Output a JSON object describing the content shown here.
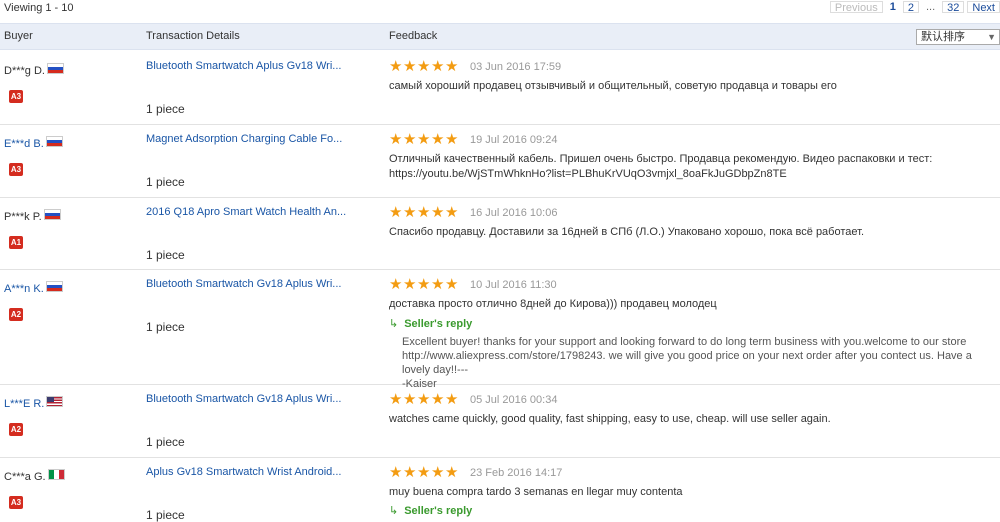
{
  "pagination": {
    "viewing": "Viewing 1 - 10",
    "prev": "Previous",
    "current": "1",
    "page2": "2",
    "ellipsis": "...",
    "last": "32",
    "next": "Next"
  },
  "columns": {
    "buyer": "Buyer",
    "transaction": "Transaction Details",
    "feedback": "Feedback",
    "sort": "默认排序"
  },
  "reviews": [
    {
      "buyer": "D***g D.",
      "flag": "ru",
      "badge": "A3",
      "product": "Bluetooth Smartwatch Aplus Gv18 Wri...",
      "qty": "1 piece",
      "stars": 5,
      "date": "03 Jun 2016 17:59",
      "text": "самый хороший продавец отзывчивый и общительный, советую продавца и товары его"
    },
    {
      "buyer": "E***d B.",
      "flag": "ru",
      "badge": "A3",
      "product": "Magnet Adsorption Charging Cable Fo...",
      "qty": "1 piece",
      "stars": 5,
      "date": "19 Jul 2016 09:24",
      "text": "Отличный качественный кабель. Пришел очень быстро. Продавца рекомендую. Видео распаковки и тест:",
      "text2": "https://youtu.be/WjSTmWhknHo?list=PLBhuKrVUqO3vmjxl_8oaFkJuGDbpZn8TE"
    },
    {
      "buyer": "P***k P.",
      "flag": "ru",
      "badge": "A1",
      "product": "2016 Q18 Apro Smart Watch Health An...",
      "qty": "1 piece",
      "stars": 5,
      "date": "16 Jul 2016 10:06",
      "text": "Спасибо продавцу. Доставили за 16дней в СПб (Л.О.) Упаковано хорошо, пока всё работает."
    },
    {
      "buyer": "A***n K.",
      "flag": "ru",
      "badge": "A2",
      "product": "Bluetooth Smartwatch Gv18 Aplus Wri...",
      "qty": "1 piece",
      "stars": 5,
      "date": "10 Jul 2016 11:30",
      "text": "доставка просто отлично 8дней до Кирова))) продавец молодец",
      "reply_label": "Seller's reply",
      "reply_line1": "Excellent buyer! thanks for your support and looking forward to do long term business with you.welcome to our store",
      "reply_line2": "http://www.aliexpress.com/store/1798243. we will give you good price on your next order after you contect us. Have a lovely day!!---",
      "reply_line3": "-Kaiser"
    },
    {
      "buyer": "L***E R.",
      "flag": "us",
      "badge": "A2",
      "product": "Bluetooth Smartwatch Gv18 Aplus Wri...",
      "qty": "1 piece",
      "stars": 5,
      "date": "05 Jul 2016 00:34",
      "text": "watches came quickly, good quality, fast shipping, easy to use, cheap. will use seller again."
    },
    {
      "buyer": "C***a G.",
      "flag": "it",
      "badge": "A3",
      "product": "Aplus Gv18 Smartwatch Wrist Android...",
      "qty": "1 piece",
      "stars": 5,
      "date": "23 Feb 2016 14:17",
      "text": "muy buena compra tardo 3 semanas en llegar muy contenta",
      "reply_label": "Seller's reply"
    }
  ],
  "icons": {
    "star": "★",
    "reply": "↳",
    "dropdown": "▼"
  },
  "colors": {
    "link": "#1a56a6",
    "badge": "#d42c1f",
    "star": "#f39c12",
    "reply": "#3a9a2e",
    "header_bg": "#e9eef7"
  }
}
